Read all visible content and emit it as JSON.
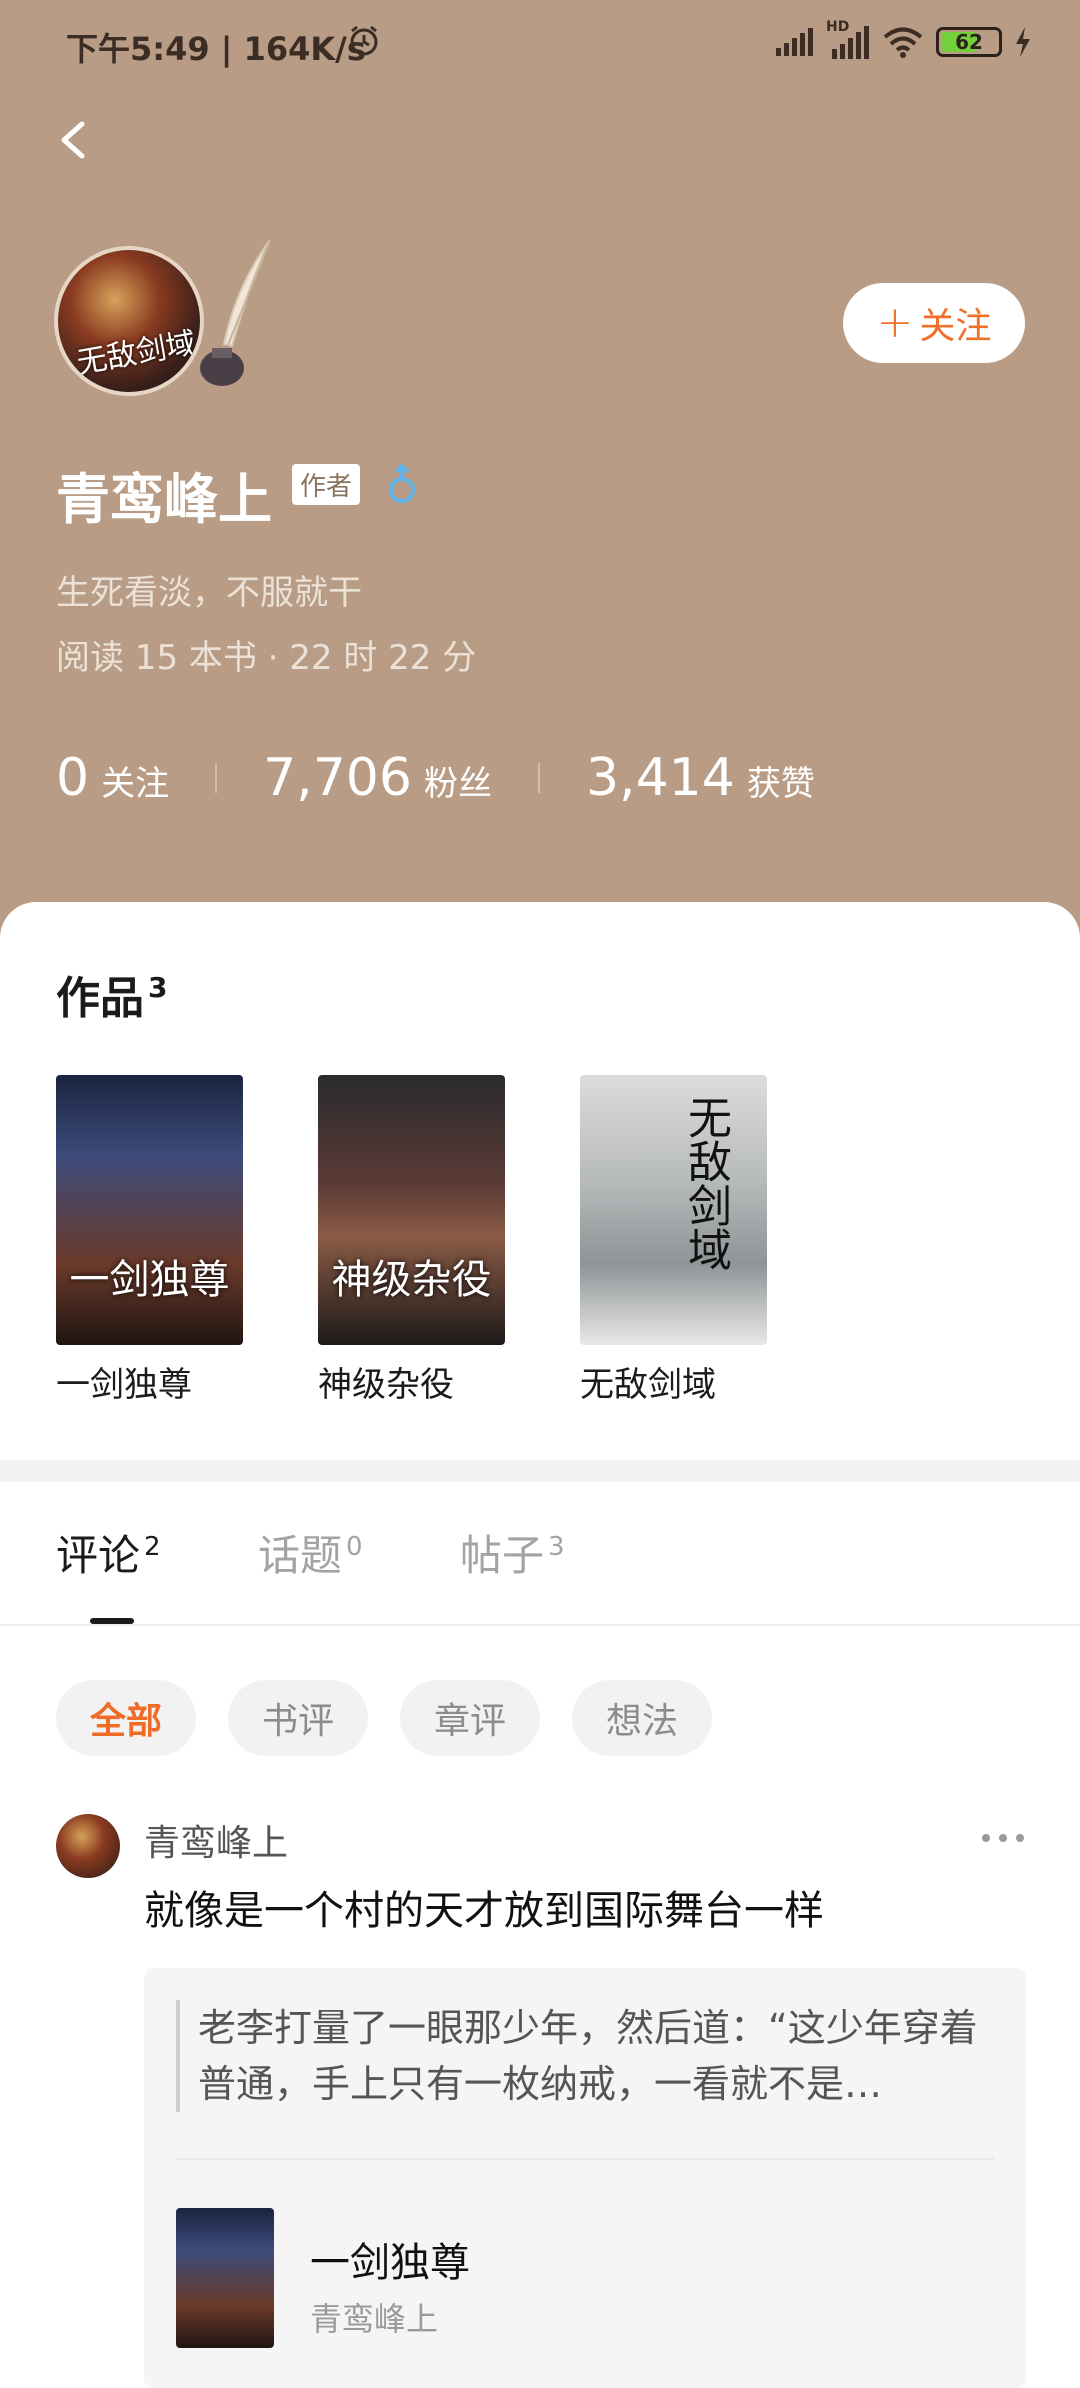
{
  "status_bar": {
    "time_speed": "下午5:49 | 164K/s",
    "battery": "62",
    "network_label": "HD"
  },
  "profile": {
    "name": "青鸾峰上",
    "badge": "作者",
    "avatar_text": "无敌剑域",
    "follow_label": "关注",
    "bio": "生死看淡，不服就干",
    "reading_stats": "阅读 15 本书 · 22 时 22 分",
    "stats": [
      {
        "num": "0",
        "label": "关注"
      },
      {
        "num": "7,706",
        "label": "粉丝"
      },
      {
        "num": "3,414",
        "label": "获赞"
      }
    ]
  },
  "works": {
    "title": "作品",
    "count": "3",
    "books": [
      {
        "title": "一剑独尊",
        "cover_text": "一剑独尊"
      },
      {
        "title": "神级杂役",
        "cover_text": "神级杂役"
      },
      {
        "title": "无敌剑域",
        "cover_text": "无敌剑域"
      }
    ]
  },
  "tabs": [
    {
      "label": "评论",
      "count": "2"
    },
    {
      "label": "话题",
      "count": "0"
    },
    {
      "label": "帖子",
      "count": "3"
    }
  ],
  "filters": [
    "全部",
    "书评",
    "章评",
    "想法"
  ],
  "comment": {
    "author": "青鸾峰上",
    "text": "就像是一个村的天才放到国际舞台一样",
    "quote": "老李打量了一眼那少年，然后道：“这少年穿着普通，手上只有一枚纳戒，一看就不是…",
    "book_title": "一剑独尊",
    "book_author": "青鸾峰上"
  },
  "colors": {
    "header_bg": "#b89c85",
    "accent": "#ef6c26"
  }
}
